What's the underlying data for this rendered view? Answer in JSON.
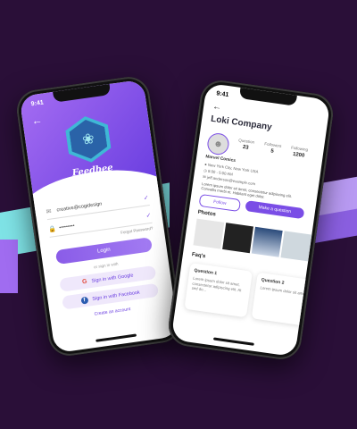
{
  "login_screen": {
    "status_time": "9:41",
    "brand": "Feedbee",
    "email_value": "creative@cogidesign",
    "password_value": "•••••••••",
    "forgot_password": "Forgot Password?",
    "login_button": "Login",
    "or_sign_in": "or sign in with",
    "google_button": "Sign in with Google",
    "facebook_button": "Sign in with Facebook",
    "create_account": "Create an account"
  },
  "profile_screen": {
    "status_time": "9:41",
    "company": "Loki Company",
    "stats": [
      {
        "label": "Question",
        "value": "23"
      },
      {
        "label": "Followers",
        "value": "5"
      },
      {
        "label": "Following",
        "value": "1200"
      }
    ],
    "name": "Marvel Comics",
    "location": "New York City, New York USA",
    "time": "8:00 - 5:00 AM",
    "email": "jeff.anderson@example.com",
    "bio": "Lorem ipsum dolor sit amet, consectetur adipiscing elit. Convallis morbi et. Habitant eget dolor.",
    "follow_button": "Follow",
    "make_question_button": "Make a question",
    "photos_title": "Photos",
    "faq_title": "Faq's",
    "faqs": [
      {
        "question": "Question 1",
        "answer": "Lorem ipsum dolor sit amet, consectetur adipiscing elit. At sed do..."
      },
      {
        "question": "Question 2",
        "answer": "Lorem ipsum dolor sit amet..."
      }
    ]
  }
}
